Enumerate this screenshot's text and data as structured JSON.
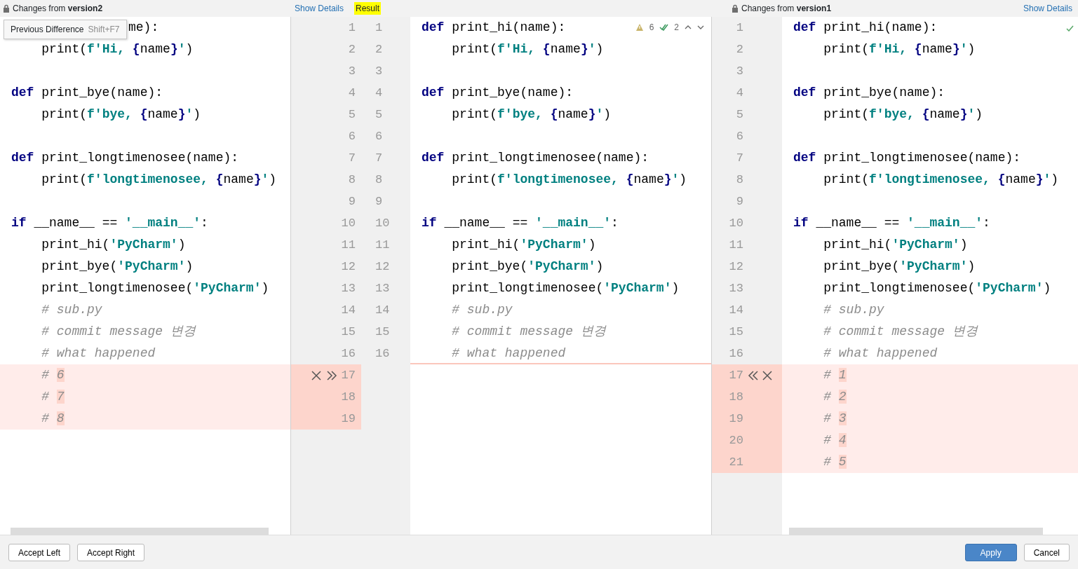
{
  "left": {
    "title": "Changes from **version2**",
    "show_details": "Show Details",
    "tooltip": {
      "label": "Previous Difference",
      "shortcut": "Shift+F7"
    },
    "lines": [
      {
        "num": "1",
        "changed": false,
        "covered": true,
        "seg": [
          {
            "kind": "plain",
            "text": "me):"
          }
        ]
      },
      {
        "num": "2",
        "changed": false,
        "seg": [
          {
            "kind": "plain",
            "text": "    print("
          },
          {
            "kind": "string",
            "text": "f'Hi, "
          },
          {
            "kind": "brace",
            "text": "{"
          },
          {
            "kind": "plain",
            "text": "name"
          },
          {
            "kind": "brace",
            "text": "}"
          },
          {
            "kind": "string",
            "text": "'"
          },
          {
            "kind": "plain",
            "text": ")"
          }
        ]
      },
      {
        "num": "3",
        "changed": false
      },
      {
        "num": "4",
        "changed": false,
        "seg": [
          {
            "kind": "keyword",
            "text": "def"
          },
          {
            "kind": "plain",
            "text": " print_bye(name):"
          }
        ]
      },
      {
        "num": "5",
        "changed": false,
        "seg": [
          {
            "kind": "plain",
            "text": "    print("
          },
          {
            "kind": "string",
            "text": "f'bye, "
          },
          {
            "kind": "brace",
            "text": "{"
          },
          {
            "kind": "plain",
            "text": "name"
          },
          {
            "kind": "brace",
            "text": "}"
          },
          {
            "kind": "string",
            "text": "'"
          },
          {
            "kind": "plain",
            "text": ")"
          }
        ]
      },
      {
        "num": "6",
        "changed": false
      },
      {
        "num": "7",
        "changed": false,
        "seg": [
          {
            "kind": "keyword",
            "text": "def"
          },
          {
            "kind": "plain",
            "text": " print_longtimenosee(name):"
          }
        ]
      },
      {
        "num": "8",
        "changed": false,
        "seg": [
          {
            "kind": "plain",
            "text": "    print("
          },
          {
            "kind": "string",
            "text": "f'longtimenosee, "
          },
          {
            "kind": "brace",
            "text": "{"
          },
          {
            "kind": "plain",
            "text": "name"
          },
          {
            "kind": "brace",
            "text": "}"
          },
          {
            "kind": "string",
            "text": "'"
          },
          {
            "kind": "plain",
            "text": ")"
          }
        ]
      },
      {
        "num": "9",
        "changed": false
      },
      {
        "num": "10",
        "changed": false,
        "seg": [
          {
            "kind": "keyword",
            "text": "if"
          },
          {
            "kind": "plain",
            "text": " __name__ == "
          },
          {
            "kind": "string",
            "text": "'__main__'"
          },
          {
            "kind": "plain",
            "text": ":"
          }
        ]
      },
      {
        "num": "11",
        "changed": false,
        "seg": [
          {
            "kind": "plain",
            "text": "    print_hi("
          },
          {
            "kind": "string",
            "text": "'PyCharm'"
          },
          {
            "kind": "plain",
            "text": ")"
          }
        ]
      },
      {
        "num": "12",
        "changed": false,
        "seg": [
          {
            "kind": "plain",
            "text": "    print_bye("
          },
          {
            "kind": "string",
            "text": "'PyCharm'"
          },
          {
            "kind": "plain",
            "text": ")"
          }
        ]
      },
      {
        "num": "13",
        "changed": false,
        "seg": [
          {
            "kind": "plain",
            "text": "    print_longtimenosee("
          },
          {
            "kind": "string",
            "text": "'PyCharm'"
          },
          {
            "kind": "plain",
            "text": ")"
          }
        ]
      },
      {
        "num": "14",
        "changed": false,
        "seg": [
          {
            "kind": "comment",
            "text": "    # sub.py"
          }
        ]
      },
      {
        "num": "15",
        "changed": false,
        "seg": [
          {
            "kind": "comment",
            "text": "    # commit message 변경"
          }
        ]
      },
      {
        "num": "16",
        "changed": false,
        "seg": [
          {
            "kind": "comment",
            "text": "    # what happened"
          }
        ]
      },
      {
        "num": "17",
        "changed": true,
        "actions": [
          {
            "kind": "close"
          },
          {
            "kind": "accept"
          }
        ],
        "seg": [
          {
            "kind": "comment",
            "text": "    # "
          },
          {
            "kind": "changed_char",
            "text": "6"
          }
        ]
      },
      {
        "num": "18",
        "changed": true,
        "seg": [
          {
            "kind": "comment",
            "text": "    # "
          },
          {
            "kind": "changed_char",
            "text": "7"
          }
        ]
      },
      {
        "num": "19",
        "changed": true,
        "seg": [
          {
            "kind": "comment",
            "text": "    # "
          },
          {
            "kind": "changed_char",
            "text": "8"
          }
        ]
      }
    ]
  },
  "middle": {
    "title": "Result",
    "warnings": "6",
    "checks": "2",
    "lines": [
      {
        "num": "1",
        "seg": [
          {
            "kind": "keyword",
            "text": "def"
          },
          {
            "kind": "plain",
            "text": " print_hi(name):"
          }
        ]
      },
      {
        "num": "2",
        "seg": [
          {
            "kind": "plain",
            "text": "    print("
          },
          {
            "kind": "string",
            "text": "f'Hi, "
          },
          {
            "kind": "brace",
            "text": "{"
          },
          {
            "kind": "plain",
            "text": "name"
          },
          {
            "kind": "brace",
            "text": "}"
          },
          {
            "kind": "string",
            "text": "'"
          },
          {
            "kind": "plain",
            "text": ")"
          }
        ]
      },
      {
        "num": "3"
      },
      {
        "num": "4",
        "seg": [
          {
            "kind": "keyword",
            "text": "def"
          },
          {
            "kind": "plain",
            "text": " print_bye(name):"
          }
        ]
      },
      {
        "num": "5",
        "seg": [
          {
            "kind": "plain",
            "text": "    print("
          },
          {
            "kind": "string",
            "text": "f'bye, "
          },
          {
            "kind": "brace",
            "text": "{"
          },
          {
            "kind": "plain",
            "text": "name"
          },
          {
            "kind": "brace",
            "text": "}"
          },
          {
            "kind": "string",
            "text": "'"
          },
          {
            "kind": "plain",
            "text": ")"
          }
        ]
      },
      {
        "num": "6"
      },
      {
        "num": "7",
        "seg": [
          {
            "kind": "keyword",
            "text": "def"
          },
          {
            "kind": "plain",
            "text": " print_longtimenosee(name):"
          }
        ]
      },
      {
        "num": "8",
        "seg": [
          {
            "kind": "plain",
            "text": "    print("
          },
          {
            "kind": "string",
            "text": "f'longtimenosee, "
          },
          {
            "kind": "brace",
            "text": "{"
          },
          {
            "kind": "plain",
            "text": "name"
          },
          {
            "kind": "brace",
            "text": "}"
          },
          {
            "kind": "string",
            "text": "'"
          },
          {
            "kind": "plain",
            "text": ")"
          }
        ]
      },
      {
        "num": "9"
      },
      {
        "num": "10",
        "seg": [
          {
            "kind": "keyword",
            "text": "if"
          },
          {
            "kind": "plain",
            "text": " __name__ == "
          },
          {
            "kind": "string",
            "text": "'__main__'"
          },
          {
            "kind": "plain",
            "text": ":"
          }
        ]
      },
      {
        "num": "11",
        "seg": [
          {
            "kind": "plain",
            "text": "    print_hi("
          },
          {
            "kind": "string",
            "text": "'PyCharm'"
          },
          {
            "kind": "plain",
            "text": ")"
          }
        ]
      },
      {
        "num": "12",
        "seg": [
          {
            "kind": "plain",
            "text": "    print_bye("
          },
          {
            "kind": "string",
            "text": "'PyCharm'"
          },
          {
            "kind": "plain",
            "text": ")"
          }
        ]
      },
      {
        "num": "13",
        "seg": [
          {
            "kind": "plain",
            "text": "    print_longtimenosee("
          },
          {
            "kind": "string",
            "text": "'PyCharm'"
          },
          {
            "kind": "plain",
            "text": ")"
          }
        ]
      },
      {
        "num": "14",
        "seg": [
          {
            "kind": "comment",
            "text": "    # sub.py"
          }
        ]
      },
      {
        "num": "15",
        "seg": [
          {
            "kind": "comment",
            "text": "    # commit message 변경"
          }
        ]
      },
      {
        "num": "16",
        "insert_below": true,
        "seg": [
          {
            "kind": "comment",
            "text": "    # what happened"
          }
        ]
      }
    ]
  },
  "right": {
    "title": "Changes from **version1**",
    "show_details": "Show Details",
    "lines": [
      {
        "num": "1",
        "changed": false,
        "seg": [
          {
            "kind": "keyword",
            "text": "def"
          },
          {
            "kind": "plain",
            "text": " print_hi(name):"
          }
        ]
      },
      {
        "num": "2",
        "changed": false,
        "seg": [
          {
            "kind": "plain",
            "text": "    print("
          },
          {
            "kind": "string",
            "text": "f'Hi, "
          },
          {
            "kind": "brace",
            "text": "{"
          },
          {
            "kind": "plain",
            "text": "name"
          },
          {
            "kind": "brace",
            "text": "}"
          },
          {
            "kind": "string",
            "text": "'"
          },
          {
            "kind": "plain",
            "text": ")"
          }
        ]
      },
      {
        "num": "3",
        "changed": false
      },
      {
        "num": "4",
        "changed": false,
        "seg": [
          {
            "kind": "keyword",
            "text": "def"
          },
          {
            "kind": "plain",
            "text": " print_bye(name):"
          }
        ]
      },
      {
        "num": "5",
        "changed": false,
        "seg": [
          {
            "kind": "plain",
            "text": "    print("
          },
          {
            "kind": "string",
            "text": "f'bye, "
          },
          {
            "kind": "brace",
            "text": "{"
          },
          {
            "kind": "plain",
            "text": "name"
          },
          {
            "kind": "brace",
            "text": "}"
          },
          {
            "kind": "string",
            "text": "'"
          },
          {
            "kind": "plain",
            "text": ")"
          }
        ]
      },
      {
        "num": "6",
        "changed": false
      },
      {
        "num": "7",
        "changed": false,
        "seg": [
          {
            "kind": "keyword",
            "text": "def"
          },
          {
            "kind": "plain",
            "text": " print_longtimenosee(name):"
          }
        ]
      },
      {
        "num": "8",
        "changed": false,
        "seg": [
          {
            "kind": "plain",
            "text": "    print("
          },
          {
            "kind": "string",
            "text": "f'longtimenosee, "
          },
          {
            "kind": "brace",
            "text": "{"
          },
          {
            "kind": "plain",
            "text": "name"
          },
          {
            "kind": "brace",
            "text": "}"
          },
          {
            "kind": "string",
            "text": "'"
          },
          {
            "kind": "plain",
            "text": ")"
          }
        ]
      },
      {
        "num": "9",
        "changed": false
      },
      {
        "num": "10",
        "changed": false,
        "seg": [
          {
            "kind": "keyword",
            "text": "if"
          },
          {
            "kind": "plain",
            "text": " __name__ == "
          },
          {
            "kind": "string",
            "text": "'__main__'"
          },
          {
            "kind": "plain",
            "text": ":"
          }
        ]
      },
      {
        "num": "11",
        "changed": false,
        "seg": [
          {
            "kind": "plain",
            "text": "    print_hi("
          },
          {
            "kind": "string",
            "text": "'PyCharm'"
          },
          {
            "kind": "plain",
            "text": ")"
          }
        ]
      },
      {
        "num": "12",
        "changed": false,
        "seg": [
          {
            "kind": "plain",
            "text": "    print_bye("
          },
          {
            "kind": "string",
            "text": "'PyCharm'"
          },
          {
            "kind": "plain",
            "text": ")"
          }
        ]
      },
      {
        "num": "13",
        "changed": false,
        "seg": [
          {
            "kind": "plain",
            "text": "    print_longtimenosee("
          },
          {
            "kind": "string",
            "text": "'PyCharm'"
          },
          {
            "kind": "plain",
            "text": ")"
          }
        ]
      },
      {
        "num": "14",
        "changed": false,
        "seg": [
          {
            "kind": "comment",
            "text": "    # sub.py"
          }
        ]
      },
      {
        "num": "15",
        "changed": false,
        "seg": [
          {
            "kind": "comment",
            "text": "    # commit message 변경"
          }
        ]
      },
      {
        "num": "16",
        "changed": false,
        "seg": [
          {
            "kind": "comment",
            "text": "    # what happened"
          }
        ]
      },
      {
        "num": "17",
        "changed": true,
        "actions": [
          {
            "kind": "accept"
          },
          {
            "kind": "close"
          }
        ],
        "seg": [
          {
            "kind": "comment",
            "text": "    # "
          },
          {
            "kind": "changed_char",
            "text": "1"
          }
        ]
      },
      {
        "num": "18",
        "changed": true,
        "seg": [
          {
            "kind": "comment",
            "text": "    # "
          },
          {
            "kind": "changed_char",
            "text": "2"
          }
        ]
      },
      {
        "num": "19",
        "changed": true,
        "seg": [
          {
            "kind": "comment",
            "text": "    # "
          },
          {
            "kind": "changed_char",
            "text": "3"
          }
        ]
      },
      {
        "num": "20",
        "changed": true,
        "seg": [
          {
            "kind": "comment",
            "text": "    # "
          },
          {
            "kind": "changed_char",
            "text": "4"
          }
        ]
      },
      {
        "num": "21",
        "changed": true,
        "seg": [
          {
            "kind": "comment",
            "text": "    # "
          },
          {
            "kind": "changed_char",
            "text": "5"
          }
        ]
      }
    ]
  },
  "buttons": [
    {
      "label": "Accept Left",
      "primary": false
    },
    {
      "label": "Accept Right",
      "primary": false
    },
    {
      "label": "Apply",
      "primary": true
    },
    {
      "label": "Cancel",
      "primary": false
    }
  ]
}
